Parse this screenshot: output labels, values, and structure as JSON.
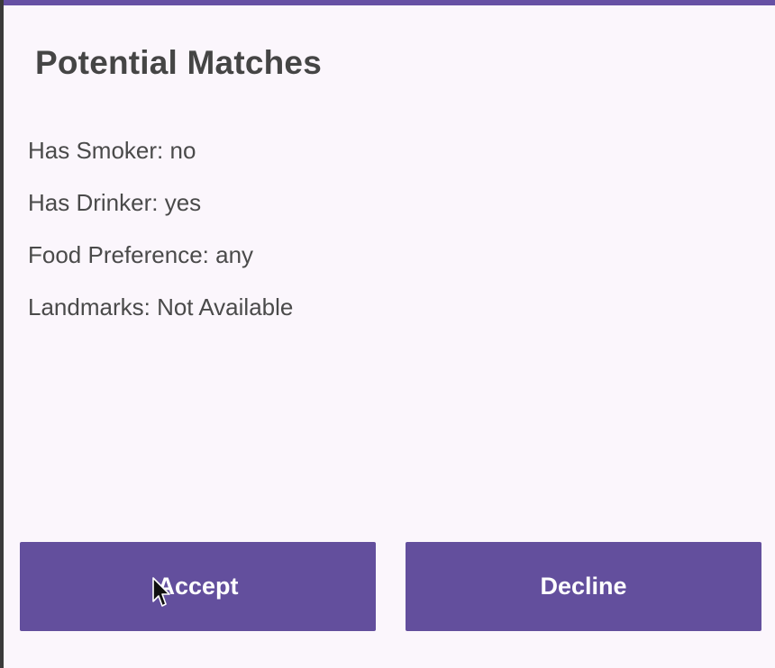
{
  "dialog": {
    "title": "Potential Matches",
    "details": [
      "Has Smoker: no",
      "Has Drinker: yes",
      "Food Preference: any",
      "Landmarks: Not Available"
    ],
    "accept_label": "Accept",
    "decline_label": "Decline"
  },
  "colors": {
    "accent": "#6650a4",
    "button": "#634f9d",
    "background": "#fbf6fc",
    "text": "#4a4a4a"
  },
  "icons": {
    "cursor": "mouse-pointer-icon"
  }
}
